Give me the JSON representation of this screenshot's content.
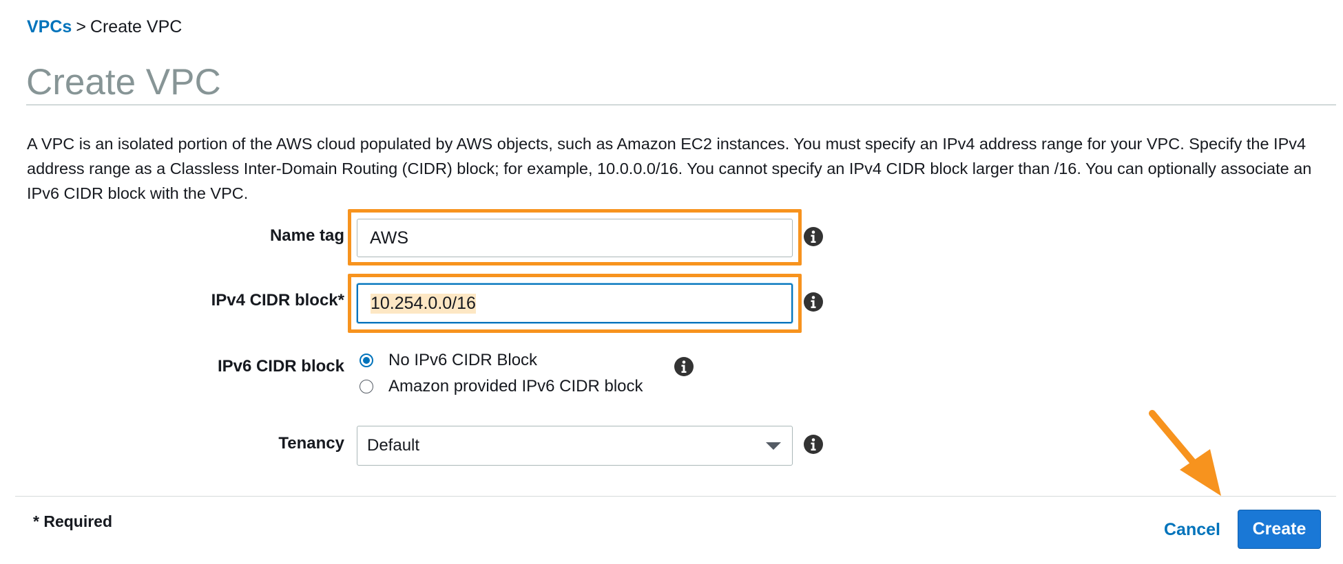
{
  "breadcrumb": {
    "parent": "VPCs",
    "separator": ">",
    "current": "Create VPC"
  },
  "page_title": "Create VPC",
  "description": "A VPC is an isolated portion of the AWS cloud populated by AWS objects, such as Amazon EC2 instances. You must specify an IPv4 address range for your VPC. Specify the IPv4 address range as a Classless Inter-Domain Routing (CIDR) block; for example, 10.0.0.0/16. You cannot specify an IPv4 CIDR block larger than /16. You can optionally associate an IPv6 CIDR block with the VPC.",
  "form": {
    "name_tag": {
      "label": "Name tag",
      "value": "AWS"
    },
    "ipv4_cidr": {
      "label": "IPv4 CIDR block*",
      "value": "10.254.0.0/16"
    },
    "ipv6_cidr": {
      "label": "IPv6 CIDR block",
      "options": [
        {
          "label": "No IPv6 CIDR Block",
          "selected": true
        },
        {
          "label": "Amazon provided IPv6 CIDR block",
          "selected": false
        }
      ]
    },
    "tenancy": {
      "label": "Tenancy",
      "value": "Default"
    }
  },
  "footer": {
    "required_note": "* Required",
    "cancel_label": "Cancel",
    "create_label": "Create"
  },
  "icons": {
    "info": "info-icon",
    "caret": "chevron-down-icon",
    "annotation_arrow": "arrow-icon"
  },
  "colors": {
    "link": "#0073bb",
    "highlight": "#f7931e",
    "primary_button": "#1a78d6",
    "title": "#879596"
  }
}
